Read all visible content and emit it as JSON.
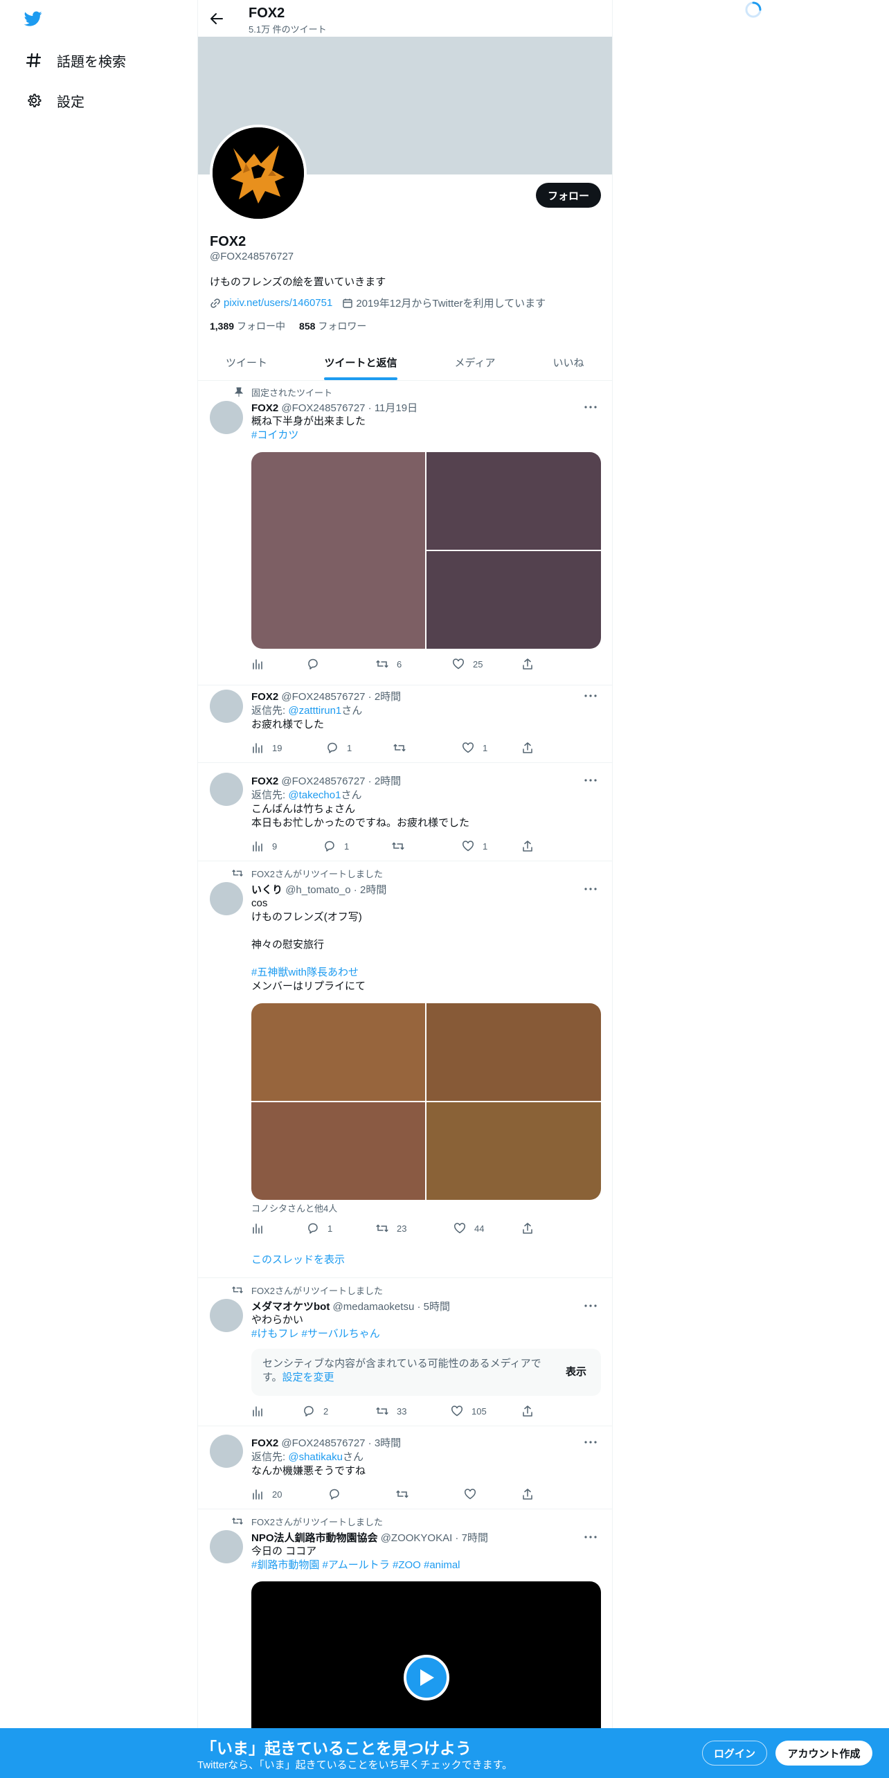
{
  "nav": {
    "items": [
      {
        "label": "話題を検索",
        "icon": "hashtag-icon"
      },
      {
        "label": "設定",
        "icon": "gear-icon"
      }
    ]
  },
  "header": {
    "title": "FOX2",
    "subtitle": "5.1万 件のツイート"
  },
  "profile": {
    "follow_label": "フォロー",
    "name": "FOX2",
    "handle": "@FOX248576727",
    "bio": "けものフレンズの絵を置いていきます",
    "link": "pixiv.net/users/1460751",
    "joined": "2019年12月からTwitterを利用しています",
    "following_count": "1,389",
    "following_label": "フォロー中",
    "followers_count": "858",
    "followers_label": "フォロワー"
  },
  "tabs": [
    {
      "label": "ツイート",
      "active": false
    },
    {
      "label": "ツイートと返信",
      "active": true
    },
    {
      "label": "メディア",
      "active": false
    },
    {
      "label": "いいね",
      "active": false
    }
  ],
  "tweets": [
    {
      "context": "固定されたツイート",
      "name": "FOX2",
      "meta": "@FOX248576727 · 11月19日",
      "lines": [
        "概ね下半身が出来ました"
      ],
      "hashtags": "#コイカツ",
      "media_colors": [
        "#7d5f64",
        "#55424f",
        "#53414e"
      ],
      "views": "",
      "replies": "",
      "retweets": "6",
      "likes": "25"
    },
    {
      "name": "FOX2",
      "meta": "@FOX248576727 · 2時間",
      "reply_prefix": "返信先: ",
      "reply_to": "@zatttirun1",
      "reply_suffix": "さん",
      "lines": [
        "お疲れ様でした"
      ],
      "views": "19",
      "replies": "1",
      "retweets": "",
      "likes": "1"
    },
    {
      "name": "FOX2",
      "meta": "@FOX248576727 · 2時間",
      "reply_prefix": "返信先: ",
      "reply_to": "@takecho1",
      "reply_suffix": "さん",
      "lines": [
        "こんばんは竹ちょさん",
        "本日もお忙しかったのですね。お疲れ様でした"
      ],
      "views": "9",
      "replies": "1",
      "retweets": "",
      "likes": "1"
    },
    {
      "context": "FOX2さんがリツイートしました",
      "name": "いくり",
      "meta": "@h_tomato_o · 2時間",
      "lines": [
        "cos",
        "けものフレンズ(オフ写)",
        "",
        "神々の慰安旅行",
        ""
      ],
      "hashtags": "#五神獣with隊長あわせ",
      "lines2": [
        "メンバーはリプライにて"
      ],
      "media_colors": [
        "#97653d",
        "#875a37",
        "#8a5a43",
        "#8a6237"
      ],
      "tagged": "コノシタさんと他4人",
      "views": "",
      "replies": "1",
      "retweets": "23",
      "likes": "44",
      "thread_link": "このスレッドを表示"
    },
    {
      "context": "FOX2さんがリツイートしました",
      "name": "メダマオケツbot",
      "meta": "@medamaoketsu · 5時間",
      "lines": [
        "やわらかい"
      ],
      "hashtags": "#けもフレ #サーバルちゃん",
      "sensitive_text": "センシティブな内容が含まれている可能性のあるメディアです。",
      "sensitive_link": "設定を変更",
      "sensitive_button": "表示",
      "views": "",
      "replies": "2",
      "retweets": "33",
      "likes": "105"
    },
    {
      "name": "FOX2",
      "meta": "@FOX248576727 · 3時間",
      "reply_prefix": "返信先: ",
      "reply_to": "@shatikaku",
      "reply_suffix": "さん",
      "lines": [
        "なんか機嫌悪そうですね"
      ],
      "views": "20",
      "replies": "",
      "retweets": "",
      "likes": ""
    },
    {
      "context": "FOX2さんがリツイートしました",
      "name": "NPO法人釧路市動物園協会",
      "meta": "@ZOOKYOKAI · 7時間",
      "lines": [
        "今日の ココア"
      ],
      "hashtags": "#釧路市動物園 #アムールトラ #ZOO #animal"
    }
  ],
  "bottom_bar": {
    "title": "「いま」起きていることを見つけよう",
    "subtitle": "Twitterなら、「いま」起きていることをいち早くチェックできます。",
    "login": "ログイン",
    "signup": "アカウント作成"
  },
  "colors": {
    "accent": "#1d9bf0",
    "banner": "#cfd9de",
    "text": "#0f1419",
    "secondary": "#536471"
  }
}
